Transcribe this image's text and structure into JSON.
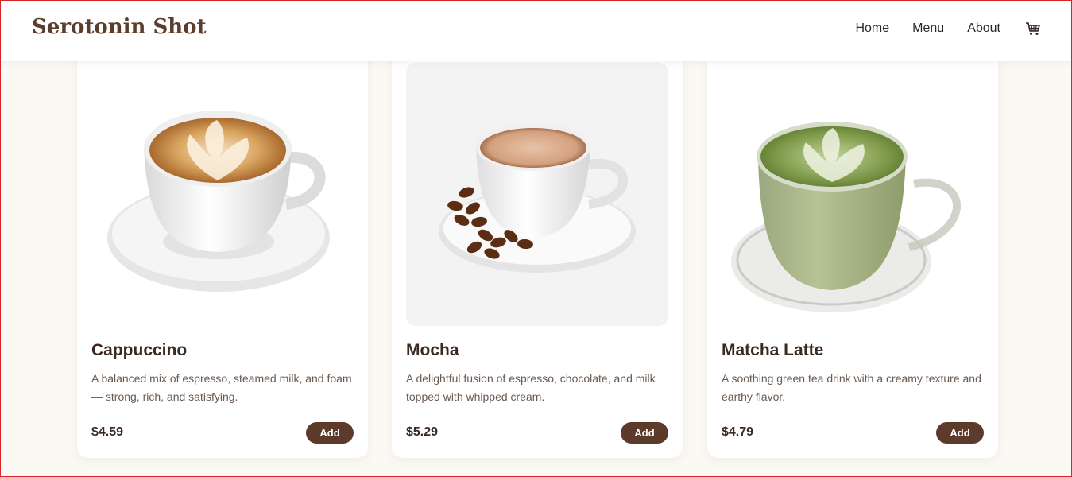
{
  "header": {
    "brand": "Serotonin Shot",
    "nav": [
      {
        "label": "Home"
      },
      {
        "label": "Menu"
      },
      {
        "label": "About"
      }
    ],
    "cart_icon": "cart-icon"
  },
  "products": [
    {
      "name": "Cappuccino",
      "description": "A balanced mix of espresso, steamed milk, and foam — strong, rich, and satisfying.",
      "price": "$4.59",
      "button": "Add",
      "image": "cappuccino-cup-image"
    },
    {
      "name": "Mocha",
      "description": "A delightful fusion of espresso, chocolate, and milk topped with whipped cream.",
      "price": "$5.29",
      "button": "Add",
      "image": "mocha-cup-image"
    },
    {
      "name": "Matcha Latte",
      "description": "A soothing green tea drink with a creamy texture and earthy flavor.",
      "price": "$4.79",
      "button": "Add",
      "image": "matcha-latte-cup-image"
    }
  ],
  "colors": {
    "brand": "#5a3d2b",
    "accent": "#5c3b2a",
    "background": "#fcf8f4"
  }
}
